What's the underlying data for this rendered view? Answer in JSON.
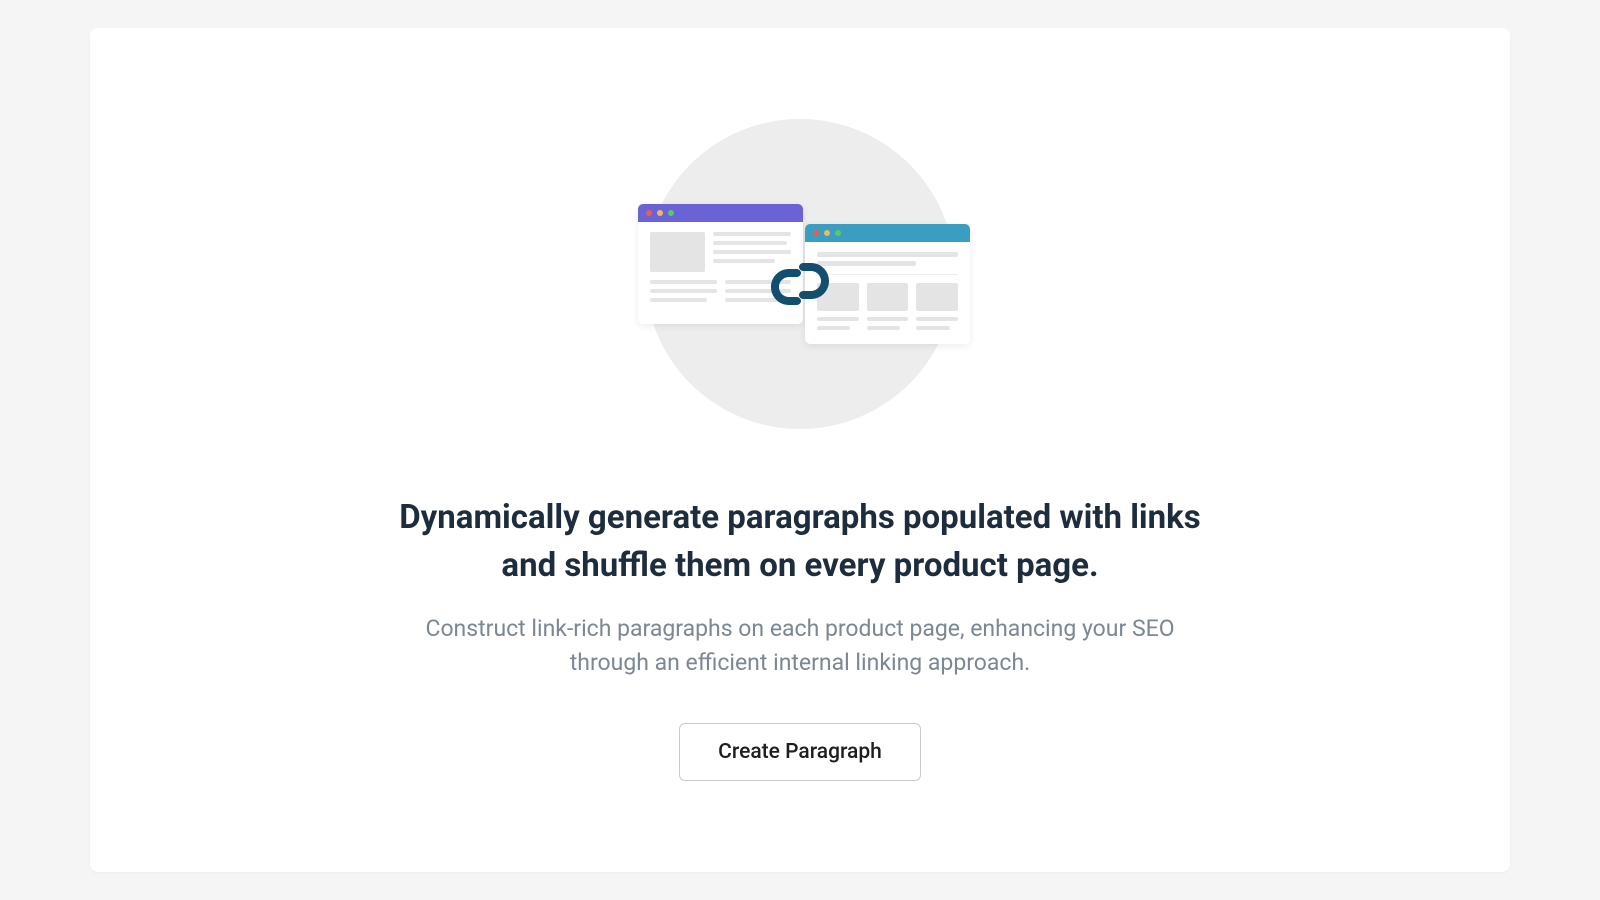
{
  "hero": {
    "headline": "Dynamically generate paragraphs populated with links and shuffle them on every product page.",
    "subtitle": "Construct link-rich paragraphs on each product page, enhancing your SEO through an efficient internal linking approach.",
    "cta_label": "Create Paragraph"
  },
  "illustration": {
    "window_1_icon": "browser-window-purple",
    "window_2_icon": "browser-window-teal",
    "link_icon": "chain-link"
  }
}
